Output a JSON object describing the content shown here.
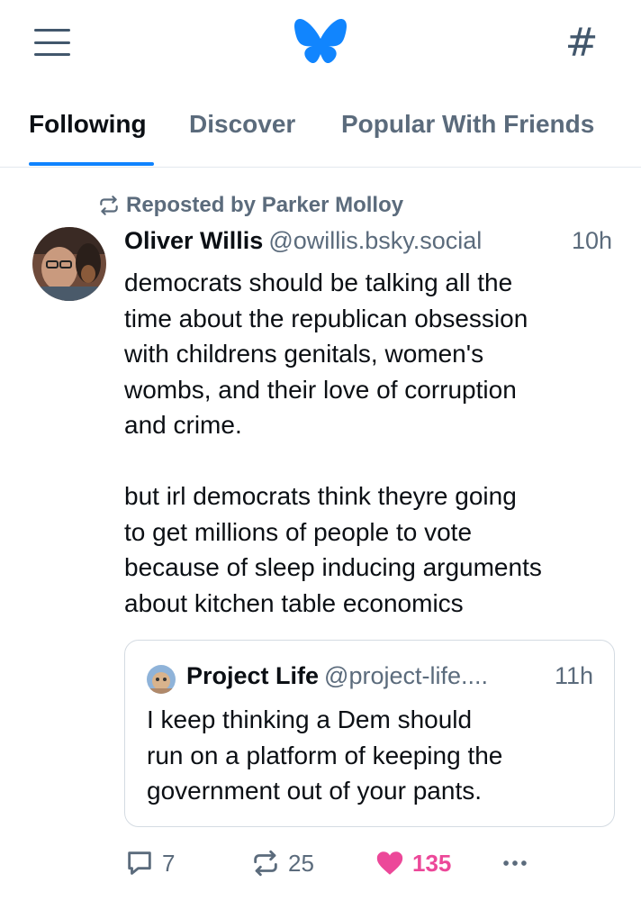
{
  "tabs": [
    "Following",
    "Discover",
    "Popular With Friends"
  ],
  "post": {
    "repost_label": "Reposted by Parker Molloy",
    "author_name": "Oliver Willis",
    "author_handle": "@owillis.bsky.social",
    "time": "10h",
    "text": "democrats should be talking all the\ntime about the republican obsession\nwith childrens genitals, women's\nwombs, and their love of corruption\nand crime.\n\nbut irl democrats think theyre going\nto get millions of people to vote\nbecause of sleep inducing arguments\nabout kitchen table economics",
    "quote": {
      "author_name": "Project Life",
      "author_handle": "@project-life....",
      "time": "11h",
      "text": "I keep thinking a Dem should\nrun on a platform of keeping the\ngovernment out of your pants."
    },
    "replies": "7",
    "reposts": "25",
    "likes": "135"
  },
  "icons": {
    "menu": "hamburger-menu-icon",
    "logo": "butterfly-logo",
    "feeds": "hashtag-icon",
    "repost": "repost-icon",
    "reply": "speech-bubble-icon",
    "like": "heart-icon",
    "more": "ellipsis-icon"
  },
  "colors": {
    "accent": "#1083fe",
    "like": "#ec4899",
    "muted": "#5b6b7c"
  }
}
